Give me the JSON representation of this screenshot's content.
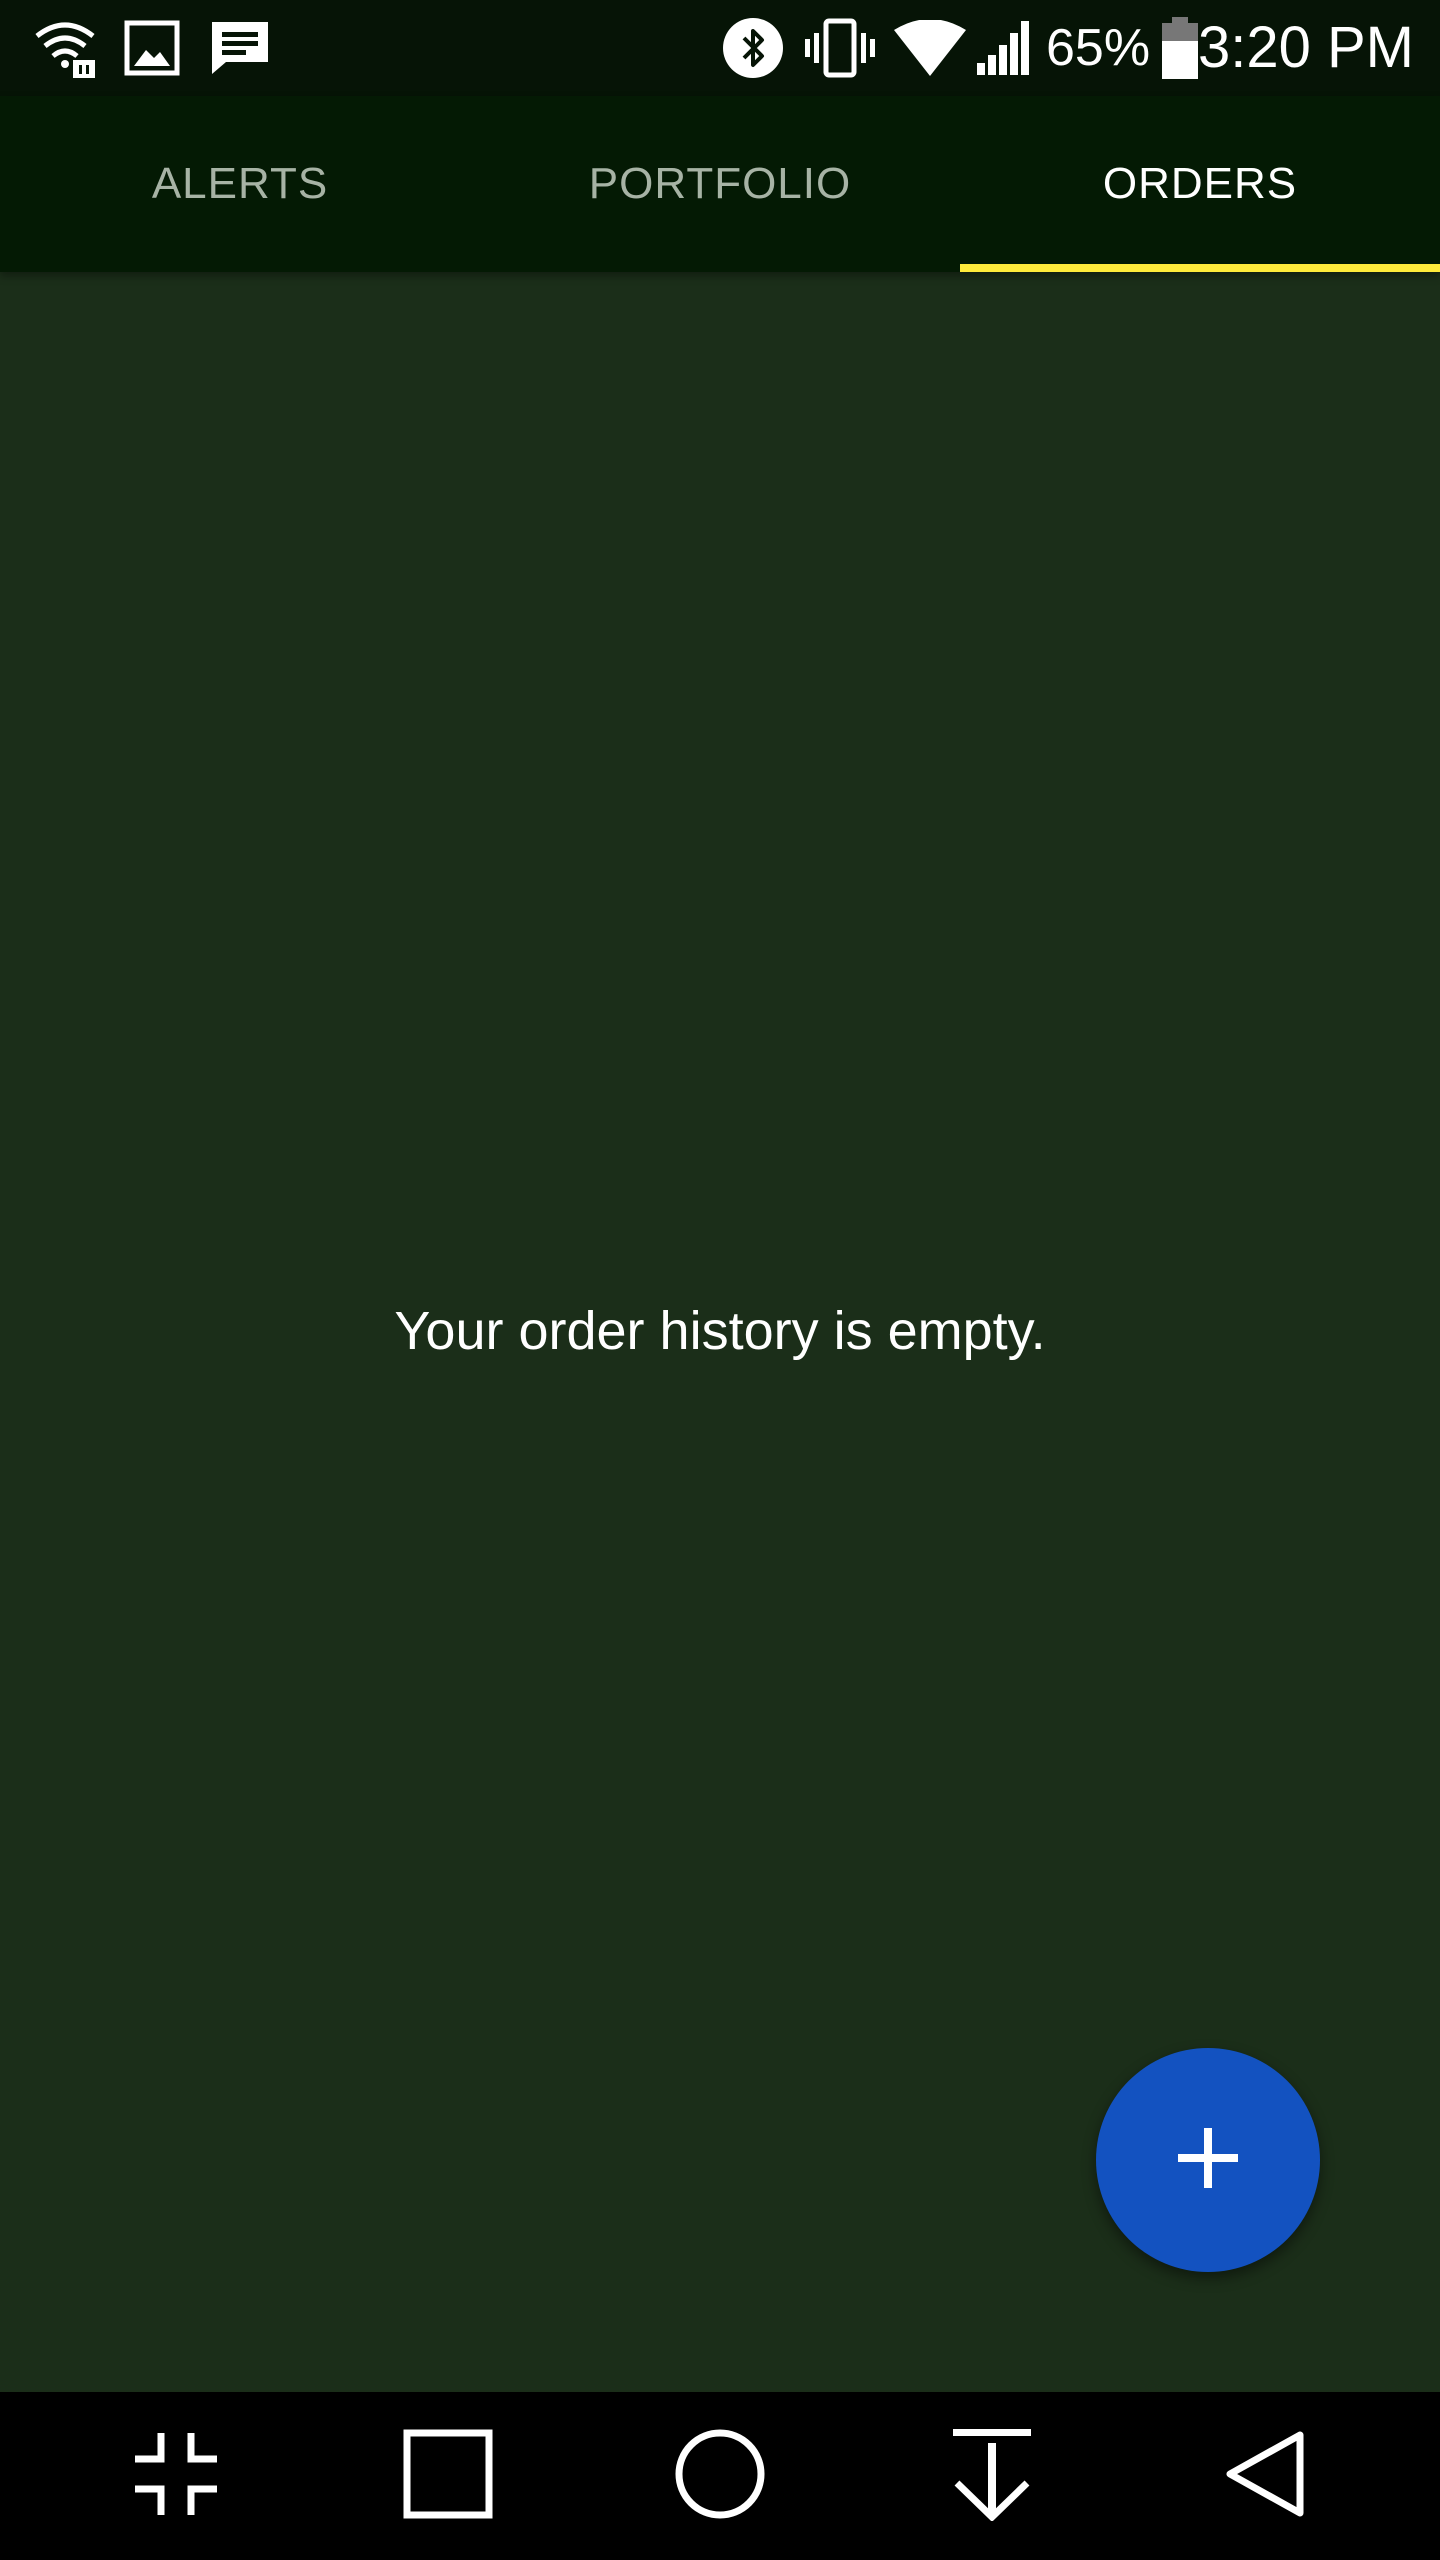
{
  "status_bar": {
    "icons_left": [
      "wifi-lock-icon",
      "image-notification-icon",
      "message-notification-icon"
    ],
    "icons_right": [
      "bluetooth-icon",
      "vibrate-icon",
      "wifi-icon",
      "signal-icon",
      "battery-icon"
    ],
    "battery_percent": "65%",
    "time": "3:20 PM"
  },
  "tabs": [
    {
      "label": "ALERTS",
      "active": false
    },
    {
      "label": "PORTFOLIO",
      "active": false
    },
    {
      "label": "ORDERS",
      "active": true
    }
  ],
  "main": {
    "empty_message": "Your order history is empty."
  },
  "fab": {
    "icon": "plus-icon",
    "color": "#1352c0"
  },
  "nav_bar": {
    "buttons": [
      "fullscreen-exit-icon",
      "recent-apps-icon",
      "home-icon",
      "notification-pull-icon",
      "back-icon"
    ]
  },
  "colors": {
    "tab_indicator": "#ffeb3b",
    "background": "#1b2e19",
    "tab_bar": "#041a04"
  }
}
